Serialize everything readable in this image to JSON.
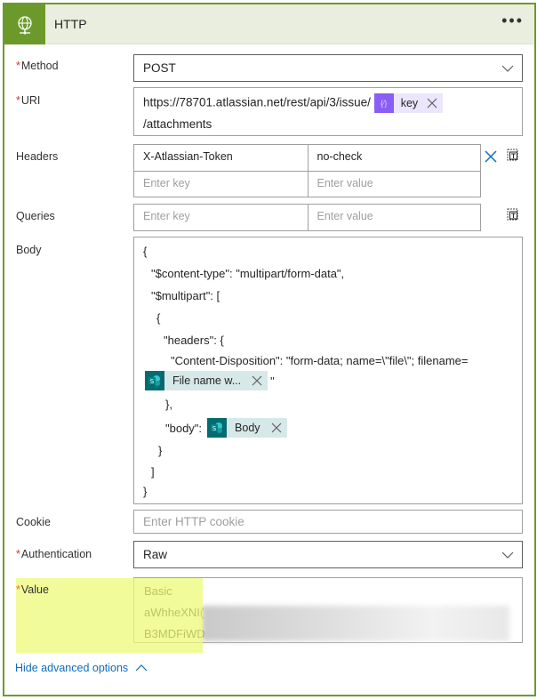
{
  "header": {
    "title": "HTTP",
    "icon": "globe-icon",
    "more_label": "•••",
    "color": "#6c9a2a"
  },
  "method": {
    "label": "Method",
    "required": "*",
    "value": "POST"
  },
  "uri": {
    "label": "URI",
    "required": "*",
    "prefix": "https://78701.atlassian.net/rest/api/3/issue/",
    "token": {
      "label": "key",
      "icon": "expression-icon",
      "color": "#8a5ef5"
    },
    "suffix": "/attachments"
  },
  "headers": {
    "label": "Headers",
    "rows": [
      {
        "key": "X-Atlassian-Token",
        "value": "no-check"
      }
    ],
    "key_placeholder": "Enter key",
    "value_placeholder": "Enter value"
  },
  "queries": {
    "label": "Queries",
    "key_placeholder": "Enter key",
    "value_placeholder": "Enter value"
  },
  "body": {
    "label": "Body",
    "lines": [
      "{",
      "\"$content-type\": \"multipart/form-data\",",
      "\"$multipart\": [",
      "{",
      "\"headers\": {",
      "\"Content-Disposition\": \"form-data; name=\\\"file\\\"; filename=",
      "\"",
      "},",
      "\"body\":",
      "}",
      "]",
      "}"
    ],
    "filename_token": {
      "label": "File name w...",
      "icon": "sharepoint-icon",
      "color": "#036c70"
    },
    "body_token": {
      "label": "Body",
      "icon": "sharepoint-icon",
      "color": "#036c70"
    }
  },
  "cookie": {
    "label": "Cookie",
    "placeholder": "Enter HTTP cookie"
  },
  "authentication": {
    "label": "Authentication",
    "required": "*",
    "value": "Raw"
  },
  "value": {
    "label": "Value",
    "required": "*",
    "lines": [
      "Basic",
      "aWhheXNI(",
      "B3MDFiWD"
    ]
  },
  "advanced": {
    "label": "Hide advanced options"
  }
}
